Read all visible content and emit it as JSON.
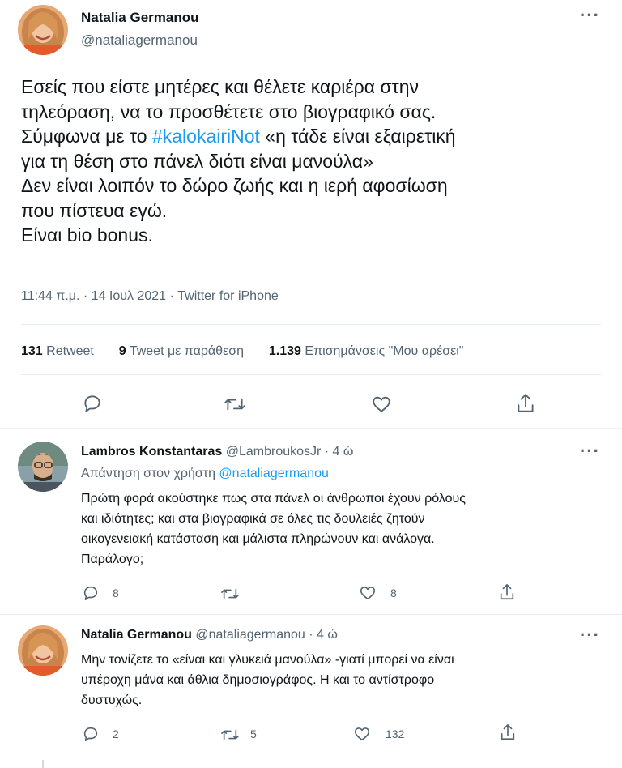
{
  "main_tweet": {
    "author_name": "Natalia Germanou",
    "author_handle": "@nataliagermanou",
    "text_line1": "Εσείς που είστε μητέρες και θέλετε καριέρα στην",
    "text_line2": "τηλεόραση, να το προσθέτετε στο βιογραφικό σας.",
    "text_line3_pre": "Σύμφωνα με το ",
    "hashtag": "#kalokairiNot",
    "text_line3_post": " «η τάδε είναι εξαιρετική",
    "text_line4": "για τη θέση στο πάνελ διότι είναι μανούλα»",
    "text_line5": "Δεν είναι λοιπόν το δώρο ζωής και η ιερή αφοσίωση",
    "text_line6": "που πίστευα εγώ.",
    "text_line7": "Είναι bio bonus.",
    "timestamp": "11:44 π.μ. · 14 Ιουλ 2021 · Twitter for iPhone",
    "stats": {
      "retweets_num": "131",
      "retweets_label": "Retweet",
      "quotes_num": "9",
      "quotes_label": "Tweet με παράθεση",
      "likes_num": "1.139",
      "likes_label": "Επισημάνσεις \"Μου αρέσει\""
    }
  },
  "reply1": {
    "author_name": "Lambros Konstantaras",
    "meta": "@LambroukosJr · 4 ώ",
    "replying_prefix": "Απάντηση στον χρήστη ",
    "replying_handle": "@nataliagermanou",
    "line1": "Πρώτη φορά ακούστηκε πως στα πάνελ οι άνθρωποι έχουν ρόλους",
    "line2": "και ιδιότητες; και στα  βιογραφικά σε όλες τις δουλειές ζητούν",
    "line3": "οικογενειακή κατάσταση και μάλιστα πληρώνουν και ανάλογα.",
    "line4": "Παράλογο;",
    "reply_count": "8",
    "retweet_count": "",
    "like_count": "8"
  },
  "reply2": {
    "author_name": "Natalia Germanou",
    "meta": "@nataliagermanou · 4 ώ",
    "line1": "Μην τονίζετε το «είναι και γλυκειά μανούλα» -γιατί μπορεί να είναι",
    "line2": "υπέροχη μάνα και άθλια δημοσιογράφος. Η και το αντίστροφο",
    "line3": "δυστυχώς.",
    "reply_count": "2",
    "retweet_count": "5",
    "like_count": "132"
  },
  "icons": {
    "reply": "reply-icon",
    "retweet": "retweet-icon",
    "like": "heart-icon",
    "share": "share-icon",
    "more": "more-icon"
  },
  "colors": {
    "link": "#1d9bf0",
    "muted": "#536471",
    "text": "#0f1419",
    "divider": "#e6ecf0"
  }
}
